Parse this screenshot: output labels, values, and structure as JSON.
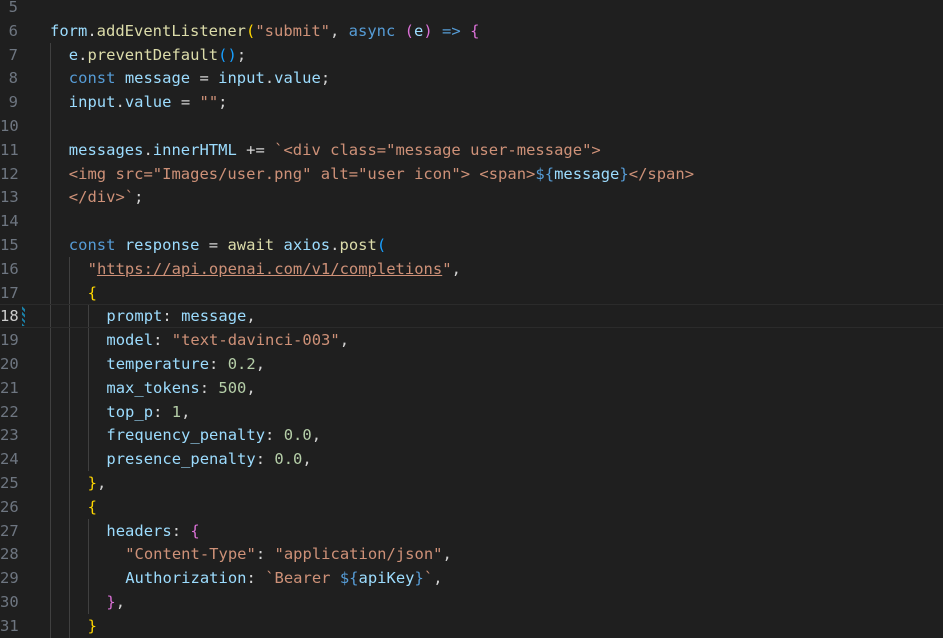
{
  "editor": {
    "active_line": 18,
    "lines": [
      {
        "n": "5",
        "indent": 0,
        "tokens": []
      },
      {
        "n": "6",
        "indent": 0,
        "tokens": [
          {
            "t": "form",
            "c": "var"
          },
          {
            "t": ".",
            "c": "pl"
          },
          {
            "t": "addEventListener",
            "c": "fn"
          },
          {
            "t": "(",
            "c": "br1"
          },
          {
            "t": "\"submit\"",
            "c": "str"
          },
          {
            "t": ", ",
            "c": "pl"
          },
          {
            "t": "async",
            "c": "kw"
          },
          {
            "t": " ",
            "c": "pl"
          },
          {
            "t": "(",
            "c": "br2"
          },
          {
            "t": "e",
            "c": "var"
          },
          {
            "t": ")",
            "c": "br2"
          },
          {
            "t": " ",
            "c": "pl"
          },
          {
            "t": "=>",
            "c": "kw"
          },
          {
            "t": " ",
            "c": "pl"
          },
          {
            "t": "{",
            "c": "br2"
          }
        ]
      },
      {
        "n": "7",
        "indent": 1,
        "tokens": [
          {
            "t": "e",
            "c": "var"
          },
          {
            "t": ".",
            "c": "pl"
          },
          {
            "t": "preventDefault",
            "c": "fn"
          },
          {
            "t": "()",
            "c": "br3"
          },
          {
            "t": ";",
            "c": "pl"
          }
        ]
      },
      {
        "n": "8",
        "indent": 1,
        "tokens": [
          {
            "t": "const",
            "c": "kw"
          },
          {
            "t": " ",
            "c": "pl"
          },
          {
            "t": "message",
            "c": "var"
          },
          {
            "t": " = ",
            "c": "pl"
          },
          {
            "t": "input",
            "c": "var"
          },
          {
            "t": ".",
            "c": "pl"
          },
          {
            "t": "value",
            "c": "var"
          },
          {
            "t": ";",
            "c": "pl"
          }
        ]
      },
      {
        "n": "9",
        "indent": 1,
        "tokens": [
          {
            "t": "input",
            "c": "var"
          },
          {
            "t": ".",
            "c": "pl"
          },
          {
            "t": "value",
            "c": "var"
          },
          {
            "t": " = ",
            "c": "pl"
          },
          {
            "t": "\"\"",
            "c": "str"
          },
          {
            "t": ";",
            "c": "pl"
          }
        ]
      },
      {
        "n": "10",
        "indent": 0,
        "tokens": []
      },
      {
        "n": "11",
        "indent": 1,
        "tokens": [
          {
            "t": "messages",
            "c": "var"
          },
          {
            "t": ".",
            "c": "pl"
          },
          {
            "t": "innerHTML",
            "c": "var"
          },
          {
            "t": " += ",
            "c": "pl"
          },
          {
            "t": "`<div class=\"message user-message\">",
            "c": "str"
          }
        ]
      },
      {
        "n": "12",
        "indent": 1,
        "tokens": [
          {
            "t": "<img src=\"Images/user.png\" alt=\"user icon\"> <span>",
            "c": "str"
          },
          {
            "t": "${",
            "c": "kw"
          },
          {
            "t": "message",
            "c": "var"
          },
          {
            "t": "}",
            "c": "kw"
          },
          {
            "t": "</span>",
            "c": "str"
          }
        ]
      },
      {
        "n": "13",
        "indent": 1,
        "tokens": [
          {
            "t": "</div>`",
            "c": "str"
          },
          {
            "t": ";",
            "c": "pl"
          }
        ]
      },
      {
        "n": "14",
        "indent": 0,
        "tokens": []
      },
      {
        "n": "15",
        "indent": 1,
        "tokens": [
          {
            "t": "const",
            "c": "kw"
          },
          {
            "t": " ",
            "c": "pl"
          },
          {
            "t": "response",
            "c": "var"
          },
          {
            "t": " = ",
            "c": "pl"
          },
          {
            "t": "await",
            "c": "fn"
          },
          {
            "t": " ",
            "c": "pl"
          },
          {
            "t": "axios",
            "c": "var"
          },
          {
            "t": ".",
            "c": "pl"
          },
          {
            "t": "post",
            "c": "fn"
          },
          {
            "t": "(",
            "c": "br3"
          }
        ]
      },
      {
        "n": "16",
        "indent": 2,
        "tokens": [
          {
            "t": "\"",
            "c": "str"
          },
          {
            "t": "https://api.openai.com/v1/completions",
            "c": "url"
          },
          {
            "t": "\"",
            "c": "str"
          },
          {
            "t": ",",
            "c": "pl"
          }
        ]
      },
      {
        "n": "17",
        "indent": 2,
        "tokens": [
          {
            "t": "{",
            "c": "br1"
          }
        ]
      },
      {
        "n": "18",
        "indent": 3,
        "tokens": [
          {
            "t": "prompt",
            "c": "var"
          },
          {
            "t": ": ",
            "c": "pl"
          },
          {
            "t": "message",
            "c": "var"
          },
          {
            "t": ",",
            "c": "pl"
          }
        ]
      },
      {
        "n": "19",
        "indent": 3,
        "tokens": [
          {
            "t": "model",
            "c": "var"
          },
          {
            "t": ": ",
            "c": "pl"
          },
          {
            "t": "\"text-davinci-003\"",
            "c": "str"
          },
          {
            "t": ",",
            "c": "pl"
          }
        ]
      },
      {
        "n": "20",
        "indent": 3,
        "tokens": [
          {
            "t": "temperature",
            "c": "var"
          },
          {
            "t": ": ",
            "c": "pl"
          },
          {
            "t": "0.2",
            "c": "num"
          },
          {
            "t": ",",
            "c": "pl"
          }
        ]
      },
      {
        "n": "21",
        "indent": 3,
        "tokens": [
          {
            "t": "max_tokens",
            "c": "var"
          },
          {
            "t": ": ",
            "c": "pl"
          },
          {
            "t": "500",
            "c": "num"
          },
          {
            "t": ",",
            "c": "pl"
          }
        ]
      },
      {
        "n": "22",
        "indent": 3,
        "tokens": [
          {
            "t": "top_p",
            "c": "var"
          },
          {
            "t": ": ",
            "c": "pl"
          },
          {
            "t": "1",
            "c": "num"
          },
          {
            "t": ",",
            "c": "pl"
          }
        ]
      },
      {
        "n": "23",
        "indent": 3,
        "tokens": [
          {
            "t": "frequency_penalty",
            "c": "var"
          },
          {
            "t": ": ",
            "c": "pl"
          },
          {
            "t": "0.0",
            "c": "num"
          },
          {
            "t": ",",
            "c": "pl"
          }
        ]
      },
      {
        "n": "24",
        "indent": 3,
        "tokens": [
          {
            "t": "presence_penalty",
            "c": "var"
          },
          {
            "t": ": ",
            "c": "pl"
          },
          {
            "t": "0.0",
            "c": "num"
          },
          {
            "t": ",",
            "c": "pl"
          }
        ]
      },
      {
        "n": "25",
        "indent": 2,
        "tokens": [
          {
            "t": "}",
            "c": "br1"
          },
          {
            "t": ",",
            "c": "pl"
          }
        ]
      },
      {
        "n": "26",
        "indent": 2,
        "tokens": [
          {
            "t": "{",
            "c": "br1"
          }
        ]
      },
      {
        "n": "27",
        "indent": 3,
        "tokens": [
          {
            "t": "headers",
            "c": "var"
          },
          {
            "t": ": ",
            "c": "pl"
          },
          {
            "t": "{",
            "c": "br2"
          }
        ]
      },
      {
        "n": "28",
        "indent": 4,
        "tokens": [
          {
            "t": "\"Content-Type\"",
            "c": "str"
          },
          {
            "t": ": ",
            "c": "pl"
          },
          {
            "t": "\"application/json\"",
            "c": "str"
          },
          {
            "t": ",",
            "c": "pl"
          }
        ]
      },
      {
        "n": "29",
        "indent": 4,
        "tokens": [
          {
            "t": "Authorization",
            "c": "var"
          },
          {
            "t": ": ",
            "c": "pl"
          },
          {
            "t": "`Bearer ",
            "c": "str"
          },
          {
            "t": "${",
            "c": "kw"
          },
          {
            "t": "apiKey",
            "c": "var"
          },
          {
            "t": "}",
            "c": "kw"
          },
          {
            "t": "`",
            "c": "str"
          },
          {
            "t": ",",
            "c": "pl"
          }
        ]
      },
      {
        "n": "30",
        "indent": 3,
        "tokens": [
          {
            "t": "}",
            "c": "br2"
          },
          {
            "t": ",",
            "c": "pl"
          }
        ]
      },
      {
        "n": "31",
        "indent": 2,
        "tokens": [
          {
            "t": "}",
            "c": "br1"
          }
        ]
      }
    ]
  },
  "colors": {
    "background": "#1f1f1f",
    "variable": "#9cdcfe",
    "function": "#dcdcaa",
    "string": "#ce9178",
    "keyword": "#569cd6",
    "number": "#b5cea8",
    "bracket_gold": "#ffd700",
    "bracket_purple": "#da70d6",
    "bracket_blue": "#179fff"
  }
}
